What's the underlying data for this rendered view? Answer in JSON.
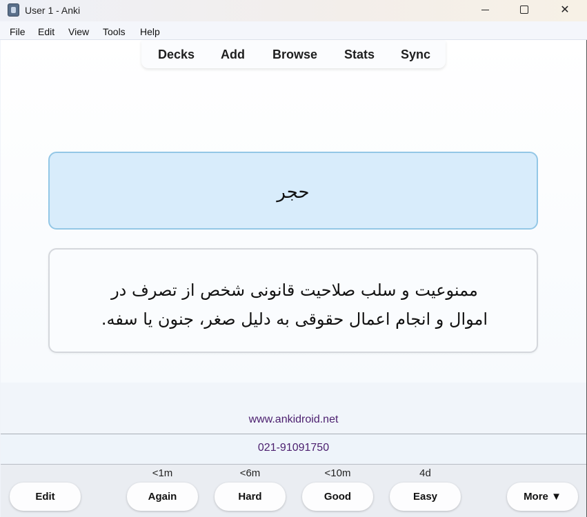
{
  "window": {
    "title": "User 1 - Anki"
  },
  "menu": {
    "file": "File",
    "edit": "Edit",
    "view": "View",
    "tools": "Tools",
    "help": "Help"
  },
  "toolbar": {
    "decks": "Decks",
    "add": "Add",
    "browse": "Browse",
    "stats": "Stats",
    "sync": "Sync"
  },
  "card": {
    "front": "حجر",
    "back_line1": "ممنوعیت و سلب صلاحیت قانونی شخص از تصرف در",
    "back_line2": "اموال و انجام اعمال حقوقی به دلیل صغر، جنون یا سفه."
  },
  "footer": {
    "link": "www.ankidroid.net",
    "phone": "021-91091750"
  },
  "answer_bar": {
    "edit": "Edit",
    "again": "Again",
    "again_interval": "<1m",
    "hard": "Hard",
    "hard_interval": "<6m",
    "good": "Good",
    "good_interval": "<10m",
    "easy": "Easy",
    "easy_interval": "4d",
    "more": "More ▼"
  },
  "colors": {
    "front_bg": "#d8ecfb",
    "front_border": "#93c7e6",
    "link": "#4b1e6e"
  }
}
